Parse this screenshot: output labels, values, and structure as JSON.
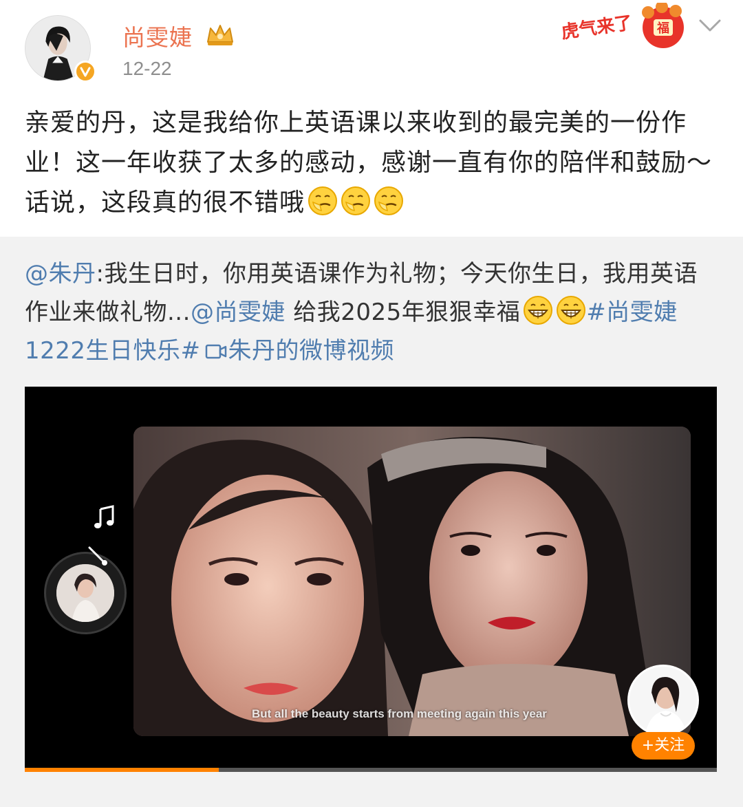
{
  "post": {
    "username": "尚雯婕",
    "date": "12-22",
    "text": "亲爱的丹，这是我给你上英语课以来收到的最完美的一份作业！这一年收获了太多的感动，感谢一直有你的陪伴和鼓励～话说，这段真的很不错哦",
    "emoji": [
      "smirk-emoji",
      "smirk-emoji",
      "smirk-emoji"
    ],
    "sticker_text": "虎气来了"
  },
  "repost": {
    "mention_author": "@朱丹",
    "text_part1": ":我生日时，你用英语课作为礼物；今天你生日，我用英语作业来做礼物...",
    "mention_tag": "@尚雯婕",
    "text_part2": " 给我2025年狠狠幸福",
    "hashtag": "#尚雯婕1222生日快乐#",
    "video_link": "朱丹的微博视频"
  },
  "video": {
    "subtitle": "But all the beauty starts from meeting again this year",
    "follow_label": "+关注",
    "progress": 0.28
  },
  "colors": {
    "username": "#eb7350",
    "link": "#507daf",
    "accent": "#ff8200",
    "repost_bg": "#f2f2f2"
  }
}
